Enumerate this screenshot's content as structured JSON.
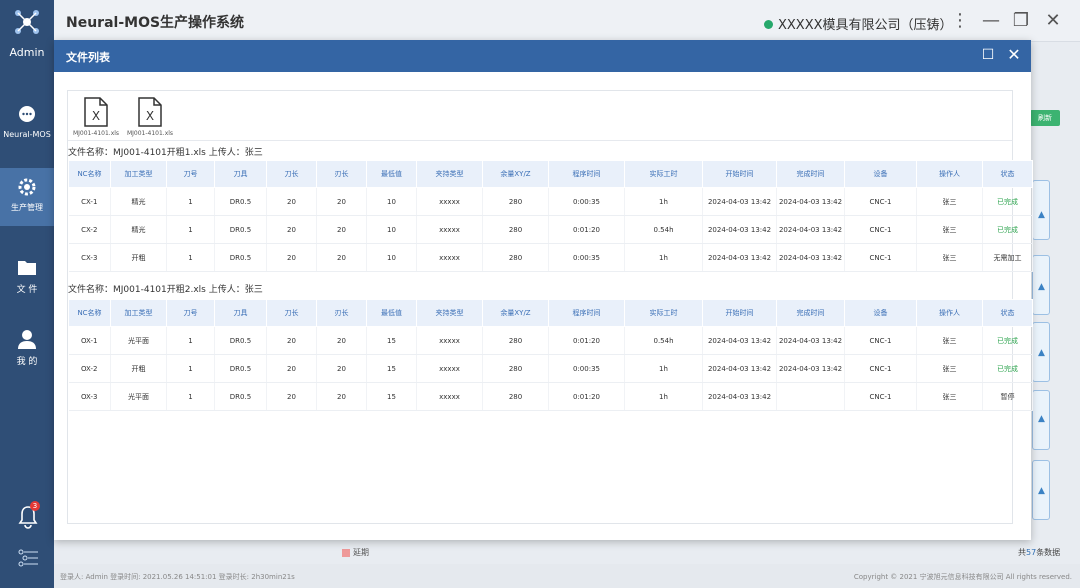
{
  "app": {
    "title": "Neural-MOS生产操作系统",
    "user": "Admin",
    "company": "XXXXX模具有限公司（压铸）"
  },
  "sidebar": {
    "items": [
      {
        "label": "Neural-MOS",
        "icon": "chat-icon"
      },
      {
        "label": "生产管理",
        "icon": "gear-icon"
      },
      {
        "label": "文 件",
        "icon": "folder-icon"
      },
      {
        "label": "我 的",
        "icon": "user-icon"
      }
    ],
    "notification_count": "3"
  },
  "background": {
    "green_button": "刷新",
    "delay_label": "延期",
    "count_prefix": "共",
    "count_value": "57",
    "count_suffix": "条数据",
    "footer_left": "登录人: Admin   登录时间: 2021.05.26 14:51:01   登录时长: 2h30min21s",
    "footer_right": "Copyright © 2021 宁波旭元信息科技有限公司 All rights reserved."
  },
  "modal": {
    "title": "文件列表",
    "files": [
      {
        "name": "MJ001-4101.xls"
      },
      {
        "name": "MJ001-4101.xls"
      }
    ],
    "headers": [
      "NC名称",
      "加工类型",
      "刀号",
      "刀具",
      "刀长",
      "刃长",
      "最低值",
      "夹持类型",
      "余量XY/Z",
      "程序时间",
      "实际工时",
      "开始时间",
      "完成时间",
      "设备",
      "操作人",
      "状态"
    ],
    "section1": {
      "label": "文件名称：MJ001-4101开粗1.xls   上传人：张三",
      "rows": [
        [
          "CX-1",
          "精光",
          "1",
          "DR0.5",
          "20",
          "20",
          "10",
          "xxxxx",
          "280",
          "0:00:35",
          "1h",
          "2024-04-03 13:42",
          "2024-04-03 13:42",
          "CNC-1",
          "张三",
          "已完成"
        ],
        [
          "CX-2",
          "精光",
          "1",
          "DR0.5",
          "20",
          "20",
          "10",
          "xxxxx",
          "280",
          "0:01:20",
          "0.54h",
          "2024-04-03 13:42",
          "2024-04-03 13:42",
          "CNC-1",
          "张三",
          "已完成"
        ],
        [
          "CX-3",
          "开粗",
          "1",
          "DR0.5",
          "20",
          "20",
          "10",
          "xxxxx",
          "280",
          "0:00:35",
          "1h",
          "2024-04-03 13:42",
          "2024-04-03 13:42",
          "CNC-1",
          "张三",
          "无需加工"
        ]
      ]
    },
    "section2": {
      "label": "文件名称：MJ001-4101开粗2.xls   上传人：张三",
      "rows": [
        [
          "OX-1",
          "光平面",
          "1",
          "DR0.5",
          "20",
          "20",
          "15",
          "xxxxx",
          "280",
          "0:01:20",
          "0.54h",
          "2024-04-03 13:42",
          "2024-04-03 13:42",
          "CNC-1",
          "张三",
          "已完成"
        ],
        [
          "OX-2",
          "开粗",
          "1",
          "DR0.5",
          "20",
          "20",
          "15",
          "xxxxx",
          "280",
          "0:00:35",
          "1h",
          "2024-04-03 13:42",
          "2024-04-03 13:42",
          "CNC-1",
          "张三",
          "已完成"
        ],
        [
          "OX-3",
          "光平面",
          "1",
          "DR0.5",
          "20",
          "20",
          "15",
          "xxxxx",
          "280",
          "0:01:20",
          "1h",
          "2024-04-03 13:42",
          "",
          "CNC-1",
          "张三",
          "暂停"
        ]
      ]
    }
  },
  "colors": {
    "sidebar": "#2f4e76",
    "modal_header": "#3465a4",
    "done": "#2ea44f",
    "header_text": "#3b6fb6"
  }
}
